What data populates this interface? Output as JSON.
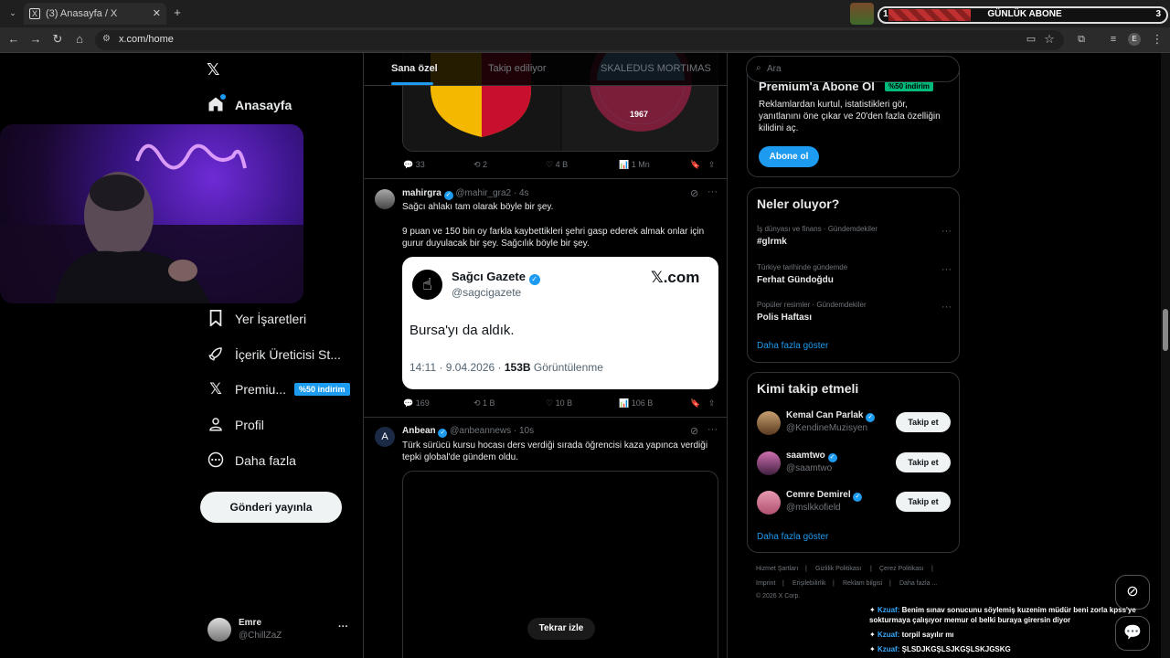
{
  "browser": {
    "tab_title": "(3) Anasayfa / X",
    "tab_favicon": "X",
    "url": "x.com/home",
    "profile_initial": "E",
    "new_tab": "+",
    "tab_close": "✕"
  },
  "subs_overlay": {
    "left": "1",
    "label": "GÜNLÜK ABONE",
    "right": "3"
  },
  "nav": {
    "logo": "𝕏",
    "items": [
      {
        "label": "Anasayfa",
        "icon": "home-icon",
        "glyph": "⌂"
      },
      {
        "label": "Yer İşaretleri",
        "icon": "bookmark-icon",
        "glyph": "🔖"
      },
      {
        "label": "İçerik Üreticisi St...",
        "icon": "rocket-icon",
        "glyph": "🚀"
      },
      {
        "label": "Premiu...",
        "icon": "x-logo-icon",
        "glyph": "𝕏"
      },
      {
        "label": "Profil",
        "icon": "person-icon",
        "glyph": "👤"
      },
      {
        "label": "Daha fazla",
        "icon": "more-circle-icon",
        "glyph": "⋯"
      }
    ],
    "premium_badge": "%50 indirim",
    "post_button": "Gönderi yayınla",
    "account": {
      "name": "Emre",
      "handle": "@ChillZaZ",
      "menu": "···"
    }
  },
  "main": {
    "tabs": [
      "Sana özel",
      "Takip ediliyor",
      "SKALEDUS MORTIMAS"
    ],
    "tweet1": {
      "image_text": "1967",
      "stats": {
        "replies": "33",
        "retweets": "2",
        "likes": "4 B",
        "views": "1 Mn"
      }
    },
    "tweet2": {
      "name": "mahirgra",
      "handle": "@mahir_gra2",
      "time": "· 4s",
      "text1": "Sağcı ahlakı tam olarak böyle bir şey.",
      "text2": "9 puan ve 150 bin oy farkla kaybettikleri şehri gasp ederek almak onlar için gurur duyulacak bir şey. Sağcılık böyle bir şey.",
      "embed": {
        "name": "Sağcı Gazete",
        "handle": "@sagcigazete",
        "brand": "𝕏.com",
        "body": "Bursa'yı da aldık.",
        "meta": "14:11 · 9.04.2026 ·",
        "views_num": "153B",
        "views_label": "Görüntülenme"
      },
      "stats": {
        "replies": "169",
        "retweets": "1 B",
        "likes": "10 B",
        "views": "106 B"
      }
    },
    "tweet3": {
      "name": "Anbean",
      "handle": "@anbeannews",
      "time": "· 10s",
      "text": "Türk sürücü kursu hocası ders verdiği sırada öğrencisi kaza yapınca verdiği tepki global'de gündem oldu.",
      "replay": "Tekrar izle"
    }
  },
  "right": {
    "search_placeholder": "Ara",
    "premium_title": "Premium'a Abone Ol",
    "premium_badge": "%50 indirim",
    "premium_text": "Reklamlardan kurtul, istatistikleri gör, yanıtlanını öne çıkar ve 20'den fazla özelliğin kilidini aç.",
    "premium_button": "Abone ol",
    "trends_title": "Neler oluyor?",
    "trends": [
      {
        "category": "İş dünyası ve finans · Gündemdekiler",
        "name": "#glrmk"
      },
      {
        "category": "Türkiye tarihinde gündemde",
        "name": "Ferhat Gündoğdu"
      },
      {
        "category": "Popüler resimler · Gündemdekiler",
        "name": "Polis Haftası"
      }
    ],
    "trends_more": "Daha fazla göster",
    "who_title": "Kimi takip etmeli",
    "who": [
      {
        "name": "Kemal Can Parlak",
        "handle": "@KendineMuzisyen",
        "button": "Takip et"
      },
      {
        "name": "saamtwo",
        "handle": "@saamtwo",
        "button": "Takip et"
      },
      {
        "name": "Cemre Demirel",
        "handle": "@mslkkofield",
        "button": "Takip et"
      }
    ],
    "who_more": "Daha fazla göster",
    "footer": [
      "Hizmet Şartları",
      "Gizlilik Politikası",
      "Çerez Politikası",
      "Imprint",
      "Erişilebilirlik",
      "Reklam bilgisi",
      "Daha fazla ...",
      "© 2026 X Corp."
    ]
  },
  "chat": [
    {
      "user": "Kzuaf:",
      "msg": "Benim sınav sonucunu söylemiş kuzenim müdür beni zorla kpss'ye sokturmaya çalışıyor memur ol belki buraya girersin diyor"
    },
    {
      "user": "Kzuaf:",
      "msg": "torpil sayılır mı"
    },
    {
      "user": "Kzuaf:",
      "msg": "ŞLSDJKGŞLSJKGŞLSKJGSKG"
    }
  ],
  "colors": {
    "accent": "#1d9bf0",
    "bg": "#000000",
    "border": "#2f3336",
    "muted": "#71767b"
  }
}
